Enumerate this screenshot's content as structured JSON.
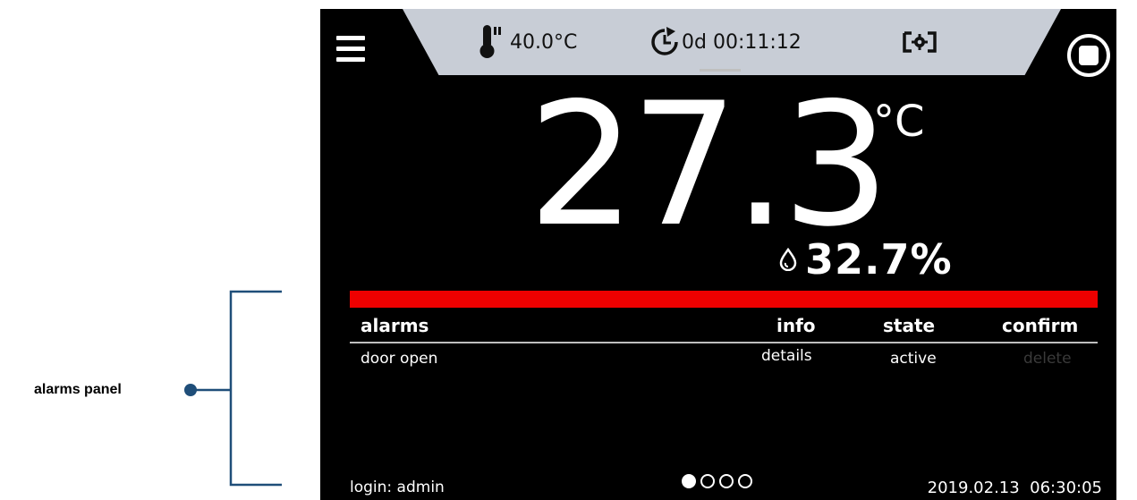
{
  "annotation": {
    "label": "alarms panel"
  },
  "status_bar": {
    "setpoint_temp": "40.0°C",
    "timer": "0d 00:11:12",
    "thermometer_icon": "thermometer-icon",
    "clock_icon": "clock-icon",
    "camera_icon": "camera-settings-icon"
  },
  "main": {
    "temperature": "27.3",
    "temperature_unit": "°C",
    "humidity": "32.7%",
    "humidity_icon": "water-drop-icon"
  },
  "alarms_panel": {
    "alarm_bar_color": "#ee0000",
    "headers": {
      "alarms": "alarms",
      "info": "info",
      "state": "state",
      "confirm": "confirm"
    },
    "rows": [
      {
        "alarm": "door open",
        "info": "details",
        "state": "active",
        "confirm": "delete"
      }
    ]
  },
  "footer": {
    "login": "login: admin",
    "pages_total": 4,
    "active_page": 1,
    "datetime": "2019.02.13  06:30:05"
  }
}
